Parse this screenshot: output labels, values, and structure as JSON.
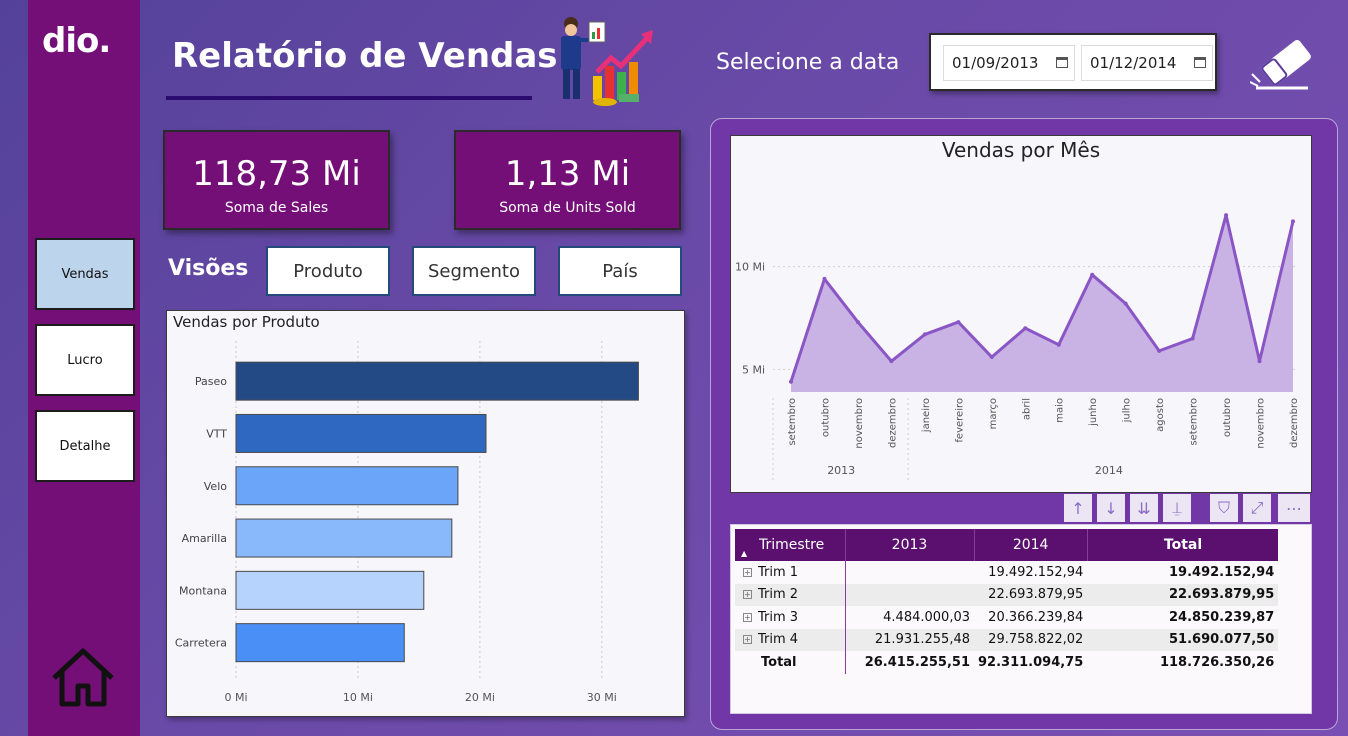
{
  "header": {
    "logo_text": "dio.",
    "title": "Relatório de Vendas",
    "date_label": "Selecione a data",
    "date_start": "01/09/2013",
    "date_end": "01/12/2014"
  },
  "sidebar": {
    "items": [
      {
        "label": "Vendas",
        "active": true
      },
      {
        "label": "Lucro",
        "active": false
      },
      {
        "label": "Detalhe",
        "active": false
      }
    ]
  },
  "kpis": [
    {
      "value": "118,73 Mi",
      "label": "Soma de  Sales"
    },
    {
      "value": "1,13 Mi",
      "label": "Soma de Units Sold"
    }
  ],
  "views": {
    "title": "Visões",
    "buttons": [
      "Produto",
      "Segmento",
      "País"
    ]
  },
  "colors": {
    "sidebar": "#750f78",
    "accent": "#5b0f6e",
    "line": "#8a56c6",
    "area": "#c9b3e4"
  },
  "chart_data": [
    {
      "type": "bar",
      "orientation": "horizontal",
      "title": "Vendas por Produto",
      "categories": [
        "Paseo",
        "VTT",
        "Velo",
        "Amarilla",
        "Montana",
        "Carretera"
      ],
      "values": [
        33.0,
        20.5,
        18.2,
        17.7,
        15.4,
        13.8
      ],
      "bar_colors": [
        "#234a84",
        "#2f68c0",
        "#6aa5f9",
        "#89b9fb",
        "#b6d3fd",
        "#4a8ff5"
      ],
      "xticks": [
        "0 Mi",
        "10 Mi",
        "20 Mi",
        "30 Mi"
      ],
      "xlim": [
        0,
        36
      ]
    },
    {
      "type": "area",
      "title": "Vendas por Mês",
      "x": [
        "setembro",
        "outubro",
        "novembro",
        "dezembro",
        "janeiro",
        "fevereiro",
        "março",
        "abril",
        "maio",
        "junho",
        "julho",
        "agosto",
        "setembro",
        "outubro",
        "novembro",
        "dezembro"
      ],
      "years": [
        {
          "label": "2013",
          "count": 4
        },
        {
          "label": "2014",
          "count": 12
        }
      ],
      "values": [
        4.4,
        9.4,
        7.3,
        5.4,
        6.7,
        7.3,
        5.6,
        7.0,
        6.2,
        9.6,
        8.2,
        5.9,
        6.5,
        12.5,
        5.4,
        12.2
      ],
      "yticks": [
        "5 Mi",
        "10 Mi"
      ],
      "ylim": [
        3.9,
        14.6
      ],
      "grid": true
    }
  ],
  "table": {
    "headers": [
      "Trimestre",
      "2013",
      "2014",
      "Total"
    ],
    "rows": [
      [
        "Trim 1",
        "",
        "19.492.152,94",
        "19.492.152,94"
      ],
      [
        "Trim 2",
        "",
        "22.693.879,95",
        "22.693.879,95"
      ],
      [
        "Trim 3",
        "4.484.000,03",
        "20.366.239,84",
        "24.850.239,87"
      ],
      [
        "Trim 4",
        "21.931.255,48",
        "29.758.822,02",
        "51.690.077,50"
      ]
    ],
    "total": [
      "Total",
      "26.415.255,51",
      "92.311.094,75",
      "118.726.350,26"
    ]
  },
  "toolbar": {
    "icons": [
      "arrow-up-icon",
      "arrow-down-icon",
      "double-arrow-down-icon",
      "expand-hierarchy-icon",
      "filter-icon",
      "focus-mode-icon",
      "more-options-icon"
    ]
  }
}
